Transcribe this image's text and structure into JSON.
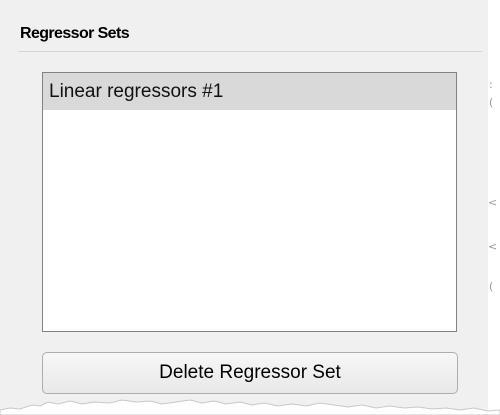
{
  "panel": {
    "title": "Regressor Sets",
    "list": {
      "items": [
        {
          "label": "Linear regressors #1",
          "selected": true
        }
      ]
    },
    "delete_button_label": "Delete Regressor Set"
  }
}
